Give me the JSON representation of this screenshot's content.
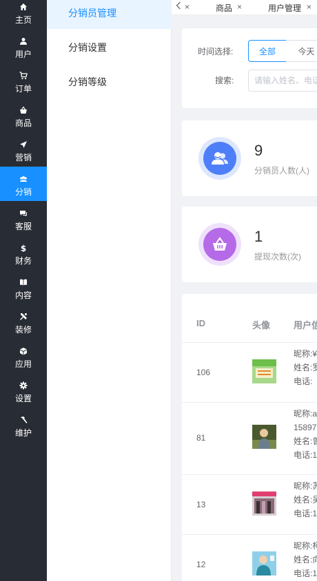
{
  "nav": [
    {
      "label": "主页",
      "icon": "home-icon"
    },
    {
      "label": "用户",
      "icon": "user-icon"
    },
    {
      "label": "订单",
      "icon": "cart-icon"
    },
    {
      "label": "商品",
      "icon": "basket-icon"
    },
    {
      "label": "营销",
      "icon": "send-icon"
    },
    {
      "label": "分销",
      "icon": "distribution-icon",
      "active": true
    },
    {
      "label": "客服",
      "icon": "chat-icon"
    },
    {
      "label": "财务",
      "icon": "dollar-icon"
    },
    {
      "label": "内容",
      "icon": "book-icon"
    },
    {
      "label": "装修",
      "icon": "tools-icon"
    },
    {
      "label": "应用",
      "icon": "cube-icon"
    },
    {
      "label": "设置",
      "icon": "gear-icon"
    },
    {
      "label": "维护",
      "icon": "hammer-icon"
    }
  ],
  "submenu": [
    {
      "label": "分销员管理",
      "active": true
    },
    {
      "label": "分销设置"
    },
    {
      "label": "分销等级"
    }
  ],
  "tabs": {
    "items": [
      "商品",
      "用户管理"
    ],
    "close": "×"
  },
  "filter": {
    "time_label": "时间选择:",
    "all_label": "全部",
    "today_label": "今天",
    "search_label": "搜索:",
    "search_placeholder": "请输入姓名、电话"
  },
  "stats": [
    {
      "value": "9",
      "label": "分销员人数(人)",
      "color": "#4e7ff8",
      "bg": "#dde7fe"
    },
    {
      "value": "1",
      "label": "提现次数(次)",
      "color": "#b56be8",
      "bg": "#efe1fb"
    }
  ],
  "table": {
    "headers": [
      "ID",
      "头像",
      "用户信"
    ],
    "rows": [
      {
        "id": "106",
        "lines": [
          "昵称:¥",
          "姓名:罗",
          "电话:"
        ]
      },
      {
        "id": "81",
        "lines": [
          "昵称:a",
          "15897",
          "姓名:曾",
          "电话:1"
        ]
      },
      {
        "id": "13",
        "lines": [
          "昵称:苏",
          "姓名:吴",
          "电话:1"
        ]
      },
      {
        "id": "12",
        "lines": [
          "昵称:柯",
          "姓名:向",
          "电话:1"
        ]
      }
    ]
  },
  "colors": {
    "primary": "#1890ff",
    "nav_bg": "#282c34"
  }
}
